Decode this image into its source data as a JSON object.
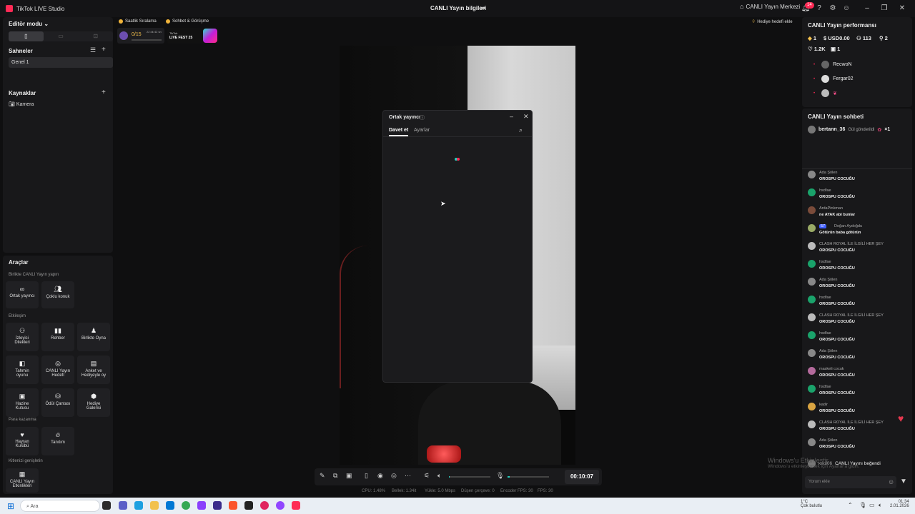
{
  "titlebar": {
    "app_title": "TikTok LIVE Studio",
    "center_title": "CANLI Yayın bilgileri",
    "live_center": "CANLI Yayın Merkezi",
    "notif_count": "14"
  },
  "sidebar": {
    "editor_mode": "Editör modu",
    "scenes_title": "Sahneler",
    "scene_item": "Genel 1",
    "sources_title": "Kaynaklar",
    "source_item": "Kamera",
    "tools_title": "Araçlar",
    "section_collab": "Birlikte CANLI Yayın yapın",
    "section_interaction": "Etkileşim",
    "section_earn": "Para kazanma",
    "section_expand": "Kitlenizi genişletin",
    "tools": {
      "cohost": "Ortak yayıncı",
      "multi_guest": "Çoklu konuk",
      "viewer_wishes_l1": "İzleyici",
      "viewer_wishes_l2": "Dilekleri",
      "guide": "Rehber",
      "play_together": "Birlikte Oyna",
      "prediction_l1": "Tahmin",
      "prediction_l2": "oyunu",
      "live_goal_l1": "CANLI Yayın",
      "live_goal_l2": "Hedefi",
      "poll_l1": "Anket ve",
      "poll_l2": "Hediyeyle oy",
      "treasure_l1": "Hazine",
      "treasure_l2": "Kutusu",
      "reward_bag": "Ödül Çantası",
      "gift_gallery_l1": "Hediye",
      "gift_gallery_l2": "Galerisi",
      "fan_club_l1": "Hayran",
      "fan_club_l2": "Kulübü",
      "promote": "Tanıtım",
      "live_events_l1": "CANLI Yayın",
      "live_events_l2": "Etkinlikleri"
    }
  },
  "top": {
    "hourly_ranking": "Saatlik Sıralama",
    "chat_meet": "Sohbet & Görüşme",
    "progress": "0/15",
    "timer_small": "22 dk 42 sn",
    "banner_text_l1": "TikTok",
    "banner_text_l2": "LIVE FEST 25",
    "gift_goal": "Hediye hedefi ekle"
  },
  "dialog": {
    "title": "Ortak yayıncı",
    "tab_invite": "Davet et",
    "tab_settings": "Ayarlar"
  },
  "controls": {
    "timer": "00:10:07",
    "volume_level": 0.02,
    "mic_level": 0.05
  },
  "stats": {
    "cpu": "CPU: 1.48%",
    "memory": "Bellek: 1.34it",
    "upload": "Yükle: 5.0 Mbps",
    "dropped": "Düşen çerçeve: 0",
    "encoder": "Encoder FPS: 30",
    "fps": "FPS: 30"
  },
  "performance": {
    "title": "CANLI Yayın performansı",
    "diamonds": "1",
    "usd": "USD0.00",
    "viewers": "113",
    "new_followers": "2",
    "likes": "1.2K",
    "gifters": "1",
    "ranking": [
      {
        "name": "RecwoN"
      },
      {
        "name": "Fergar02"
      },
      {
        "name": ""
      }
    ]
  },
  "chat": {
    "title": "CANLI Yayın sohbeti",
    "pinned_user": "bertann_36",
    "pinned_text": "Gül gönderildi",
    "pinned_count": "×1",
    "messages": [
      {
        "user": "Ada Şölen",
        "text": "OROSPU COCUĞU"
      },
      {
        "user": "hsdfae",
        "text": "OROSPU COCUĞU"
      },
      {
        "user": "ArdaPinkman",
        "text": "ne AYAK abi bunlar"
      },
      {
        "user": "Doğan Aydoğdu",
        "text": "Götürün baba götürün",
        "level": "57"
      },
      {
        "user": "CLASH ROYAL İLE İLGİLİ HER ŞEY",
        "text": "OROSPU COCUĞU"
      },
      {
        "user": "hsdfae",
        "text": "OROSPU COCUĞU"
      },
      {
        "user": "Ada Şölen",
        "text": "OROSPU COCUĞU"
      },
      {
        "user": "hsdfae",
        "text": "OROSPU COCUĞU"
      },
      {
        "user": "CLASH ROYAL İLE İLGİLİ HER ŞEY",
        "text": "OROSPU COCUĞU"
      },
      {
        "user": "hsdfae",
        "text": "OROSPU COCUĞU"
      },
      {
        "user": "Ada Şölen",
        "text": "OROSPU COCUĞU"
      },
      {
        "user": "maskeli cocuk",
        "text": "OROSPU COCUĞU"
      },
      {
        "user": "hsdfae",
        "text": "OROSPU COCUĞU"
      },
      {
        "user": "kadir",
        "text": "OROSPU COCUĞU"
      },
      {
        "user": "CLASH ROYAL İLE İLGİLİ HER ŞEY",
        "text": "OROSPU COCUĞU"
      },
      {
        "user": "Ada Şölen",
        "text": "OROSPU COCUĞU"
      }
    ],
    "liked_user": "kedi06",
    "liked_text": "CANLI Yayını beğendi",
    "comment_placeholder": "Yorum ekle"
  },
  "watermark": {
    "line1": "Windows'u Etkinleştir",
    "line2": "Windows'u etkinleştirmek için Ayarlar'a gidin."
  },
  "taskbar": {
    "search": "Ara",
    "weather_temp": "1°C",
    "weather_text": "Çok bulutlu",
    "time": "01:34",
    "date": "2.01.2026"
  },
  "colors": {
    "accent": "#ff2a55",
    "teal": "#26d0c0",
    "panel": "#18181a"
  }
}
